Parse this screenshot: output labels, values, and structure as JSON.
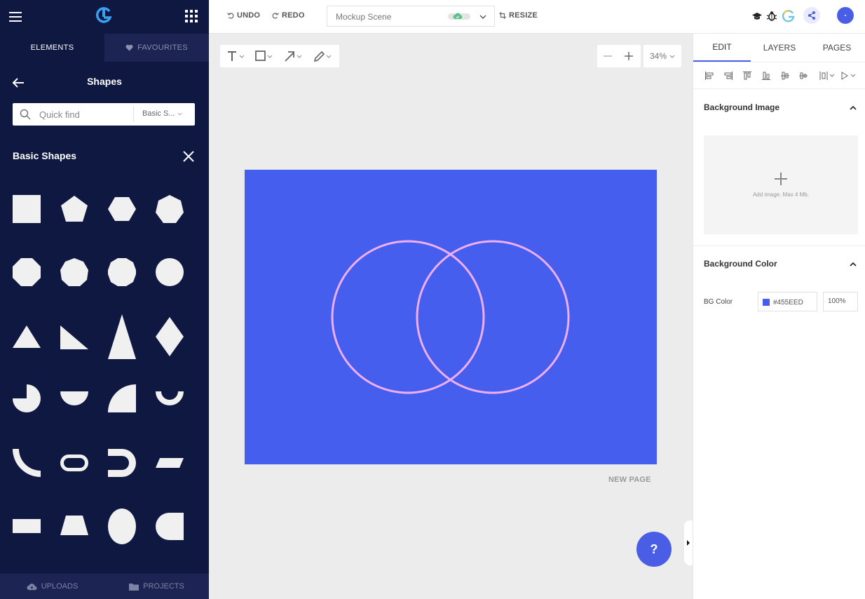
{
  "sidebar": {
    "tabs": {
      "elements": "ELEMENTS",
      "favourites": "FAVOURITES"
    },
    "title": "Shapes",
    "search": {
      "placeholder": "Quick find",
      "filter": "Basic S..."
    },
    "category_title": "Basic Shapes",
    "shape_color": "#f0f0f0",
    "bottom_tabs": {
      "uploads": "UPLOADS",
      "projects": "PROJECTS"
    }
  },
  "toolbar": {
    "undo": "UNDO",
    "redo": "REDO",
    "scene_name": "Mockup Scene",
    "resize": "RESIZE"
  },
  "canvas": {
    "zoom": "34%",
    "background": "#455EED",
    "circle_stroke": "#f0aef5",
    "new_page": "NEW PAGE",
    "help": "?"
  },
  "right_panel": {
    "tabs": {
      "edit": "EDIT",
      "layers": "LAYERS",
      "pages": "PAGES"
    },
    "background_image": {
      "title": "Background Image",
      "add_label": "Add image. Max 4 Mb."
    },
    "background_color": {
      "title": "Background Color",
      "label": "BG Color",
      "hex": "#455EED",
      "opacity": "100%"
    }
  },
  "colors": {
    "accent": "#4a5ee5",
    "sidebar_bg": "#0f1840"
  }
}
